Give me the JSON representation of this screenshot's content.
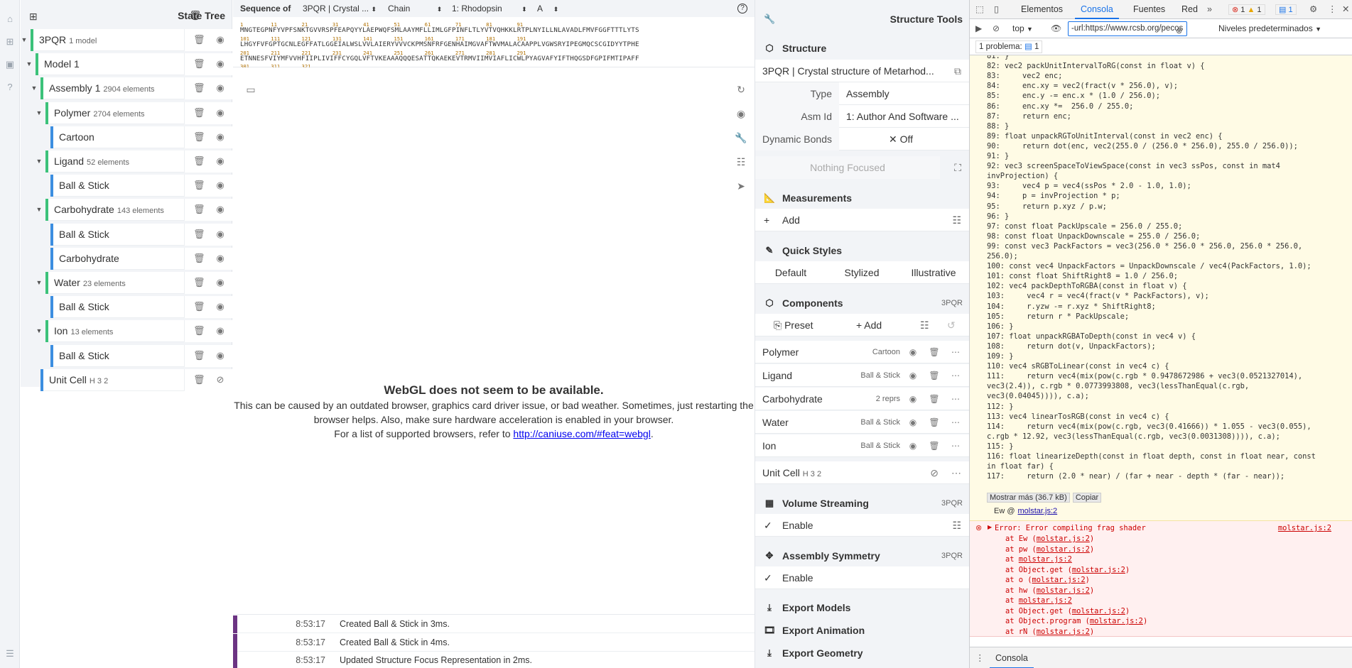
{
  "state_tree": {
    "title": "State Tree",
    "rows": [
      {
        "label": "3PQR",
        "sub": "1 model",
        "bar": "#3cc27a"
      },
      {
        "label": "Model 1",
        "sub": "",
        "bar": "#3cc27a"
      },
      {
        "label": "Assembly 1",
        "sub": "2904 elements",
        "bar": "#3cc27a"
      },
      {
        "label": "Polymer",
        "sub": "2704 elements",
        "bar": "#3cc27a"
      },
      {
        "label": "Cartoon",
        "sub": "",
        "bar": "#3c8ee0"
      },
      {
        "label": "Ligand",
        "sub": "52 elements",
        "bar": "#3cc27a"
      },
      {
        "label": "Ball & Stick",
        "sub": "",
        "bar": "#3c8ee0"
      },
      {
        "label": "Carbohydrate",
        "sub": "143 elements",
        "bar": "#3cc27a"
      },
      {
        "label": "Ball & Stick",
        "sub": "",
        "bar": "#3c8ee0"
      },
      {
        "label": "Carbohydrate",
        "sub": "",
        "bar": "#3c8ee0"
      },
      {
        "label": "Water",
        "sub": "23 elements",
        "bar": "#3cc27a"
      },
      {
        "label": "Ball & Stick",
        "sub": "",
        "bar": "#3c8ee0"
      },
      {
        "label": "Ion",
        "sub": "13 elements",
        "bar": "#3cc27a"
      },
      {
        "label": "Ball & Stick",
        "sub": "",
        "bar": "#3c8ee0"
      },
      {
        "label": "Unit Cell",
        "sub": "H 3 2",
        "bar": "#3c8ee0"
      }
    ]
  },
  "sequence": {
    "label": "Sequence of",
    "entity": "3PQR | Crystal ...",
    "mode": "Chain",
    "chain_value": "1: Rhodopsin",
    "chain_letter": "A",
    "help": "?",
    "num1": "1         11        21        31        41        51        61        71        81        91",
    "line1": "MNGTEGPNFYVPFSNKTGVVRSPFEAPQYYLAEPWQFSMLAAYMFLLIMLGFPINFLTLYVTVQHKKLRTPLNYILLNLAVADLFMVFGGFTTTLYTS",
    "num2": "101       111       121       131       141       151       161       171       181       191",
    "line2": "LHGYFVFGPTGCNLEGFFATLGGEIALWSLVVLAIERYVVVCKPMSNFRFGENHAIMGVAFTWVMALACAAPPLVGWSRYIPEGMQCSCGIDYYTPHE",
    "num3": "201       211       221       231       241       251       261       271       281       291",
    "line3": "ETNNESFVIYMFVVHFIIPLIVIFFCYGQLVFTVKEAAAQQQESATTQKAEKEVTRMVIIMVIAFLICWLPYAGVAFYIFTHQGSDFGPIFMTIPAFF",
    "num4": "301       311       321"
  },
  "webgl": {
    "title": "WebGL does not seem to be available.",
    "line1": "This can be caused by an outdated browser, graphics card driver issue, or bad weather. Sometimes, just restarting the",
    "line2": "browser helps. Also, make sure hardware acceleration is enabled in your browser.",
    "line3": "For a list of supported browsers, refer to",
    "link": "http://caniuse.com/#feat=webgl",
    "line3_end": "."
  },
  "log": [
    {
      "time": "8:53:17",
      "msg": "Created Ball & Stick in 3ms."
    },
    {
      "time": "8:53:17",
      "msg": "Created Ball & Stick in 4ms."
    },
    {
      "time": "8:53:17",
      "msg": "Updated Structure Focus Representation in 2ms."
    }
  ],
  "tools": {
    "title": "Structure Tools",
    "structure": {
      "header": "Structure",
      "name": "3PQR | Crystal structure of Metarhod...",
      "type_label": "Type",
      "type_value": "Assembly",
      "asm_label": "Asm Id",
      "asm_value": "1: Author And Software ...",
      "bonds_label": "Dynamic Bonds",
      "bonds_value": "Off",
      "focus": "Nothing Focused"
    },
    "measurements": {
      "header": "Measurements",
      "add": "Add"
    },
    "quick_styles": {
      "header": "Quick Styles",
      "default": "Default",
      "stylized": "Stylized",
      "illustrative": "Illustrative"
    },
    "components": {
      "header": "Components",
      "tag": "3PQR",
      "preset": "Preset",
      "add": "Add",
      "items": [
        {
          "name": "Polymer",
          "repr": "Cartoon"
        },
        {
          "name": "Ligand",
          "repr": "Ball & Stick"
        },
        {
          "name": "Carbohydrate",
          "repr": "2 reprs"
        },
        {
          "name": "Water",
          "repr": "Ball & Stick"
        },
        {
          "name": "Ion",
          "repr": "Ball & Stick"
        }
      ],
      "unit_cell": "Unit Cell",
      "unit_cell_sub": "H 3 2"
    },
    "volume": {
      "header": "Volume Streaming",
      "tag": "3PQR",
      "enable": "Enable"
    },
    "symmetry": {
      "header": "Assembly Symmetry",
      "tag": "3PQR",
      "enable": "Enable"
    },
    "export_models": "Export Models",
    "export_animation": "Export Animation",
    "export_geometry": "Export Geometry"
  },
  "devtools": {
    "tabs": [
      "Elementos",
      "Consola",
      "Fuentes",
      "Red"
    ],
    "active_tab": "Consola",
    "err_count": "1",
    "warn_count": "1",
    "msg_count": "1",
    "context": "top",
    "filter": "-url:https://www.rcsb.org/pecos",
    "levels": "Niveles predeterminados",
    "problems": "1 problema:",
    "problems_count": "1",
    "code_lines": [
      "81: }",
      "82: vec2 packUnitIntervalToRG(const in float v) {",
      "83:     vec2 enc;",
      "84:     enc.xy = vec2(fract(v * 256.0), v);",
      "85:     enc.y -= enc.x * (1.0 / 256.0);",
      "86:     enc.xy *=  256.0 / 255.0;",
      "87:     return enc;",
      "88: }",
      "89: float unpackRGToUnitInterval(const in vec2 enc) {",
      "90:     return dot(enc, vec2(255.0 / (256.0 * 256.0), 255.0 / 256.0));",
      "91: }",
      "92: vec3 screenSpaceToViewSpace(const in vec3 ssPos, const in mat4",
      "invProjection) {",
      "93:     vec4 p = vec4(ssPos * 2.0 - 1.0, 1.0);",
      "94:     p = invProjection * p;",
      "95:     return p.xyz / p.w;",
      "96: }",
      "97: const float PackUpscale = 256.0 / 255.0;",
      "98: const float UnpackDownscale = 255.0 / 256.0;",
      "99: const vec3 PackFactors = vec3(256.0 * 256.0 * 256.0, 256.0 * 256.0,",
      "256.0);",
      "100: const vec4 UnpackFactors = UnpackDownscale / vec4(PackFactors, 1.0);",
      "101: const float ShiftRight8 = 1.0 / 256.0;",
      "102: vec4 packDepthToRGBA(const in float v) {",
      "103:     vec4 r = vec4(fract(v * PackFactors), v);",
      "104:     r.yzw -= r.xyz * ShiftRight8;",
      "105:     return r * PackUpscale;",
      "106: }",
      "107: float unpackRGBAToDepth(const in vec4 v) {",
      "108:     return dot(v, UnpackFactors);",
      "109: }",
      "110: vec4 sRGBToLinear(const in vec4 c) {",
      "111:     return vec4(mix(pow(c.rgb * 0.9478672986 + vec3(0.0521327014),",
      "vec3(2.4)), c.rgb * 0.0773993808, vec3(lessThanEqual(c.rgb,",
      "vec3(0.04045)))), c.a);",
      "112: }",
      "113: vec4 linearTosRGB(const in vec4 c) {",
      "114:     return vec4(mix(pow(c.rgb, vec3(0.41666)) * 1.055 - vec3(0.055),",
      "c.rgb * 12.92, vec3(lessThanEqual(c.rgb, vec3(0.0031308)))), c.a);",
      "115: }",
      "116: float linearizeDepth(const in float depth, const in float near, const",
      "in float far) {",
      "117:     return (2.0 * near) / (far + near - depth * (far - near));"
    ],
    "show_more": "Mostrar más (36.7 kB)",
    "copy": "Copiar",
    "source_prefix": "Ew @",
    "source_link": "molstar.js:2",
    "error_title": "Error: Error compiling frag shader",
    "error_src": "molstar.js:2",
    "stack": [
      {
        "fn": "at Ew (",
        "file": "molstar.js:2",
        "end": ")"
      },
      {
        "fn": "at pw (",
        "file": "molstar.js:2",
        "end": ")"
      },
      {
        "fn": "at ",
        "file": "molstar.js:2",
        "end": ""
      },
      {
        "fn": "at Object.get (",
        "file": "molstar.js:2",
        "end": ")"
      },
      {
        "fn": "at o (",
        "file": "molstar.js:2",
        "end": ")"
      },
      {
        "fn": "at hw (",
        "file": "molstar.js:2",
        "end": ")"
      },
      {
        "fn": "at ",
        "file": "molstar.js:2",
        "end": ""
      },
      {
        "fn": "at Object.get (",
        "file": "molstar.js:2",
        "end": ")"
      },
      {
        "fn": "at Object.program (",
        "file": "molstar.js:2",
        "end": ")"
      },
      {
        "fn": "at rN (",
        "file": "molstar.js:2",
        "end": ")"
      }
    ],
    "drawer_tab": "Consola"
  }
}
